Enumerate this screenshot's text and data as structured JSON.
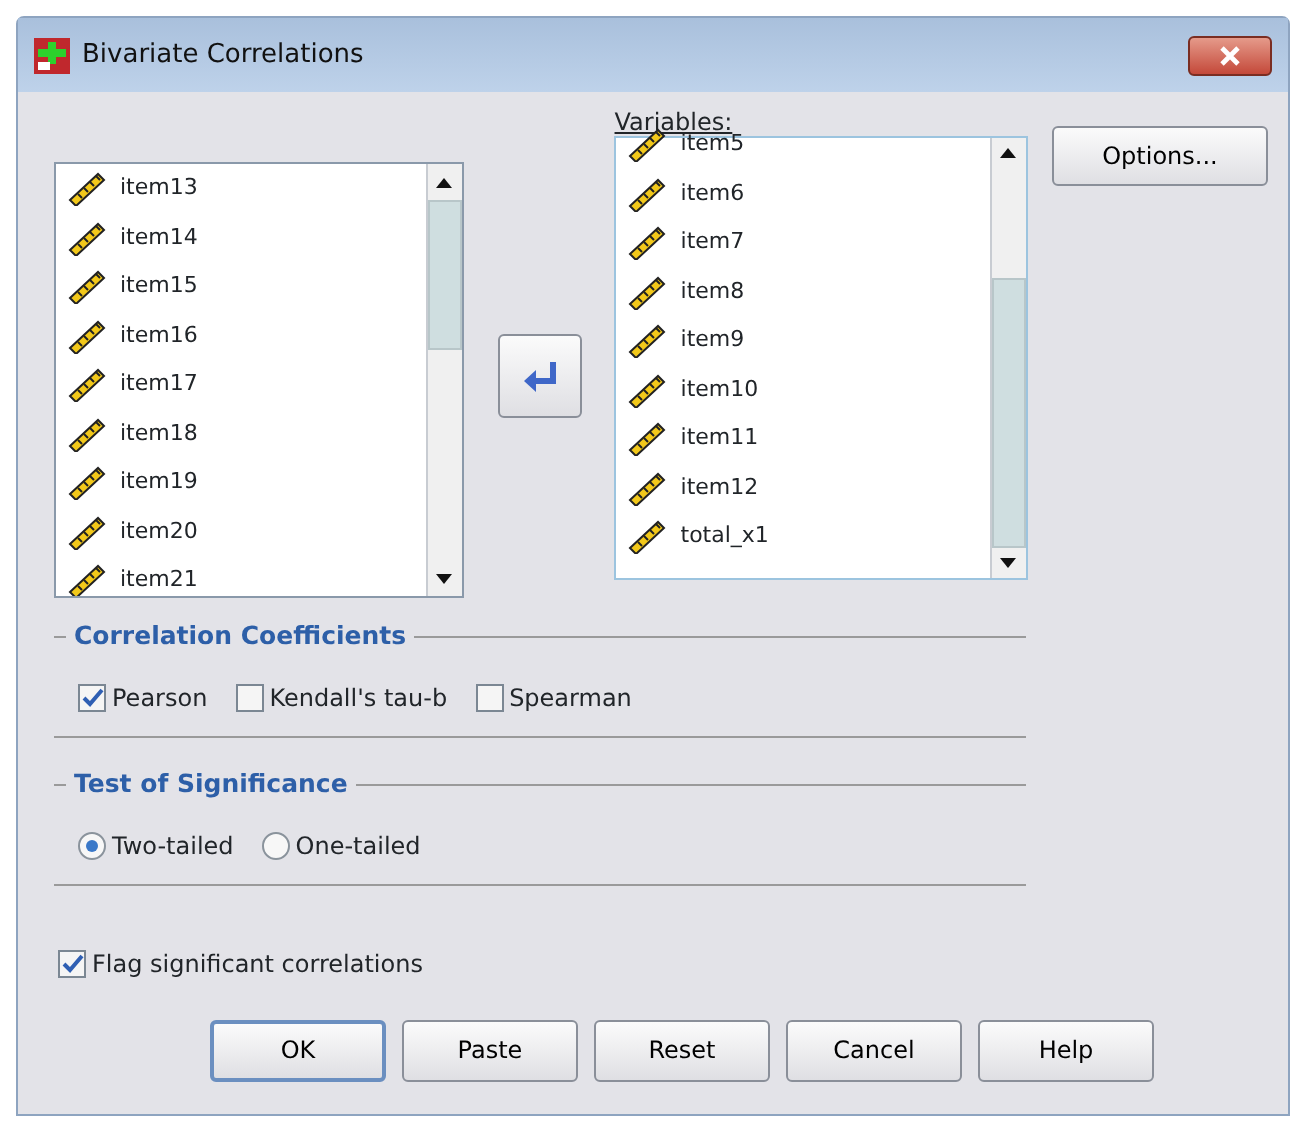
{
  "window": {
    "title": "Bivariate Correlations"
  },
  "source_list": {
    "items": [
      {
        "label": "item13"
      },
      {
        "label": "item14"
      },
      {
        "label": "item15"
      },
      {
        "label": "item16"
      },
      {
        "label": "item17"
      },
      {
        "label": "item18"
      },
      {
        "label": "item19"
      },
      {
        "label": "item20"
      },
      {
        "label": "item21"
      }
    ]
  },
  "variables": {
    "label": "Variables:",
    "items": [
      {
        "label": "item5"
      },
      {
        "label": "item6"
      },
      {
        "label": "item7"
      },
      {
        "label": "item8"
      },
      {
        "label": "item9"
      },
      {
        "label": "item10"
      },
      {
        "label": "item11"
      },
      {
        "label": "item12"
      },
      {
        "label": "total_x1"
      }
    ]
  },
  "options_button": "Options...",
  "correlation_coefficients": {
    "title": "Correlation Coefficients",
    "options": [
      {
        "label": "Pearson",
        "checked": true
      },
      {
        "label": "Kendall's tau-b",
        "checked": false
      },
      {
        "label": "Spearman",
        "checked": false
      }
    ]
  },
  "test_of_significance": {
    "title": "Test of Significance",
    "options": [
      {
        "label": "Two-tailed",
        "selected": true
      },
      {
        "label": "One-tailed",
        "selected": false
      }
    ]
  },
  "flag": {
    "label": "Flag significant correlations",
    "checked": true
  },
  "buttons": [
    {
      "label": "OK",
      "default": true
    },
    {
      "label": "Paste",
      "default": false
    },
    {
      "label": "Reset",
      "default": false
    },
    {
      "label": "Cancel",
      "default": false
    },
    {
      "label": "Help",
      "default": false
    }
  ]
}
